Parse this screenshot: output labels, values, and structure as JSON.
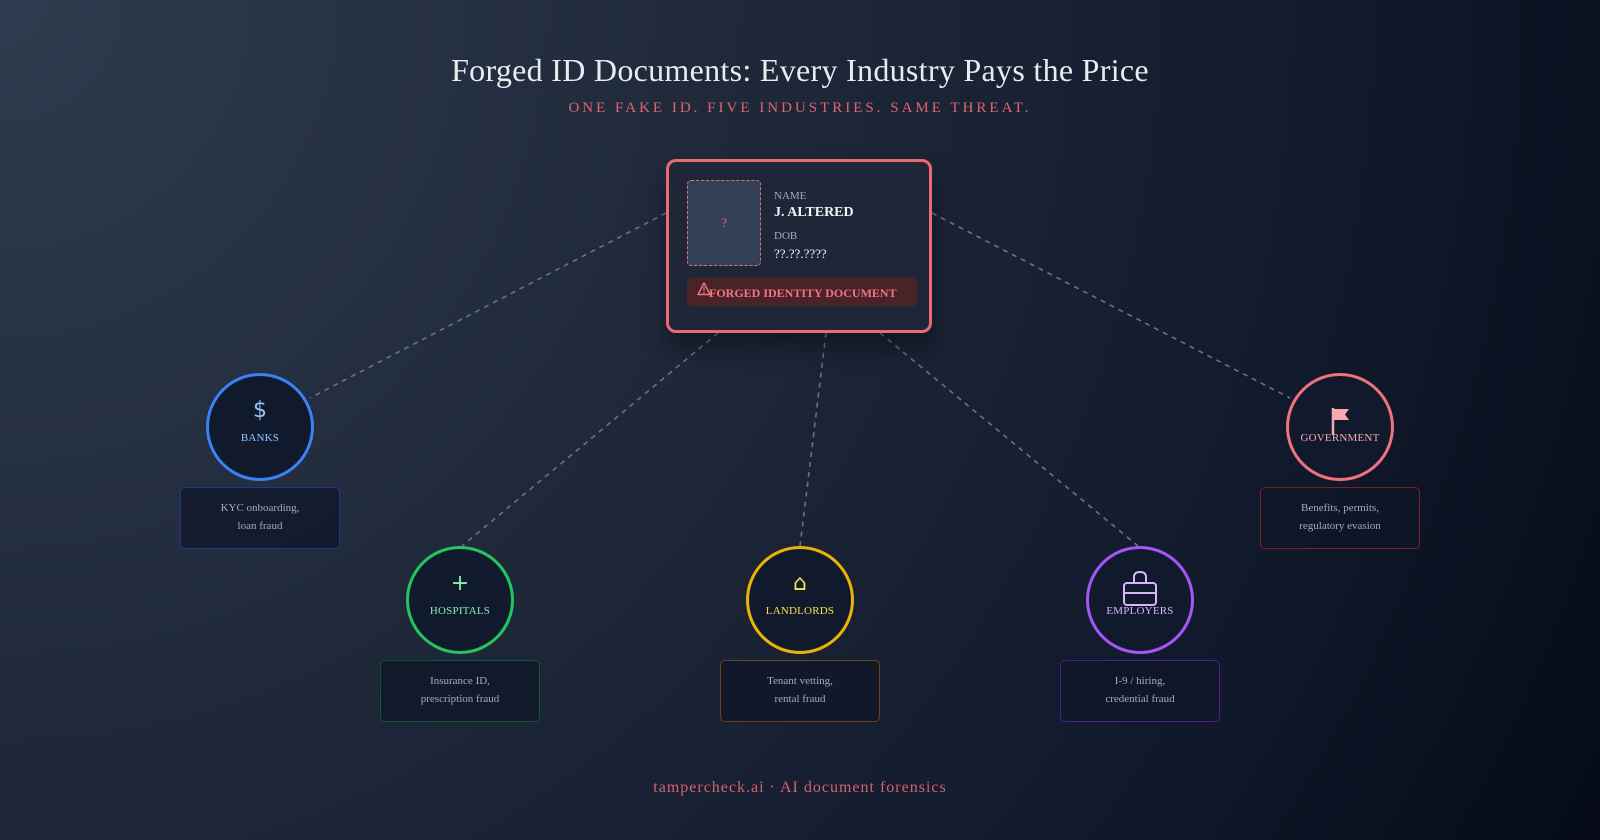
{
  "header": {
    "title": "Forged ID Documents: Every Industry Pays the Price",
    "subtitle": "ONE FAKE ID. FIVE INDUSTRIES. SAME THREAT."
  },
  "id_card": {
    "photo_placeholder": "?",
    "name_label": "NAME",
    "name_value": "J. ALTERED",
    "dob_label": "DOB",
    "dob_value": "??.??.????",
    "banner_icon": "warning-triangle-icon",
    "banner_text": "FORGED IDENTITY DOCUMENT",
    "accent_color": "#e86a72"
  },
  "industries": [
    {
      "id": "banks",
      "label": "BANKS",
      "icon": "dollar-icon",
      "icon_glyph": "$",
      "color": "#3b82f6",
      "label_color": "#93c5fd",
      "desc_border": "#1e3a8a",
      "desc_line1": "KYC onboarding,",
      "desc_line2": "loan fraud"
    },
    {
      "id": "hospitals",
      "label": "HOSPITALS",
      "icon": "plus-icon",
      "icon_glyph": "+",
      "color": "#22c55e",
      "label_color": "#86efac",
      "desc_border": "#14532d",
      "desc_line1": "Insurance ID,",
      "desc_line2": "prescription fraud"
    },
    {
      "id": "landlords",
      "label": "LANDLORDS",
      "icon": "house-icon",
      "icon_glyph": "⌂",
      "color": "#eab308",
      "label_color": "#fde047",
      "desc_border": "#713f12",
      "desc_line1": "Tenant vetting,",
      "desc_line2": "rental fraud"
    },
    {
      "id": "employers",
      "label": "EMPLOYERS",
      "icon": "briefcase-icon",
      "icon_glyph": "",
      "color": "#a855f7",
      "label_color": "#d8b4fe",
      "desc_border": "#4c1d95",
      "desc_line1": "I-9 / hiring,",
      "desc_line2": "credential fraud"
    },
    {
      "id": "government",
      "label": "GOVERNMENT",
      "icon": "flag-icon",
      "icon_glyph": "",
      "color": "#f0727a",
      "label_color": "#f9a8b0",
      "desc_border": "#7f1d1d",
      "desc_line1": "Benefits, permits,",
      "desc_line2": "regulatory evasion"
    }
  ],
  "footer": {
    "text": "tampercheck.ai · AI document forensics"
  },
  "colors": {
    "connector": "#6b7280",
    "background_dark": "#050a18",
    "background_light": "#2f3b4e"
  }
}
